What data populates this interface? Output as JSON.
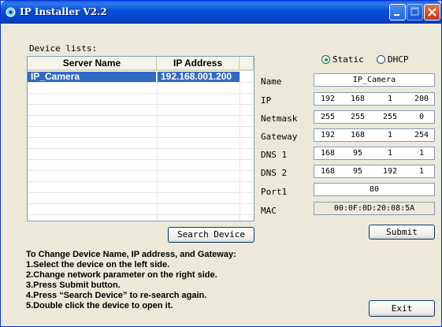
{
  "window": {
    "title": "IP Installer V2.2"
  },
  "device_list": {
    "label": "Device lists:",
    "columns": [
      "Server Name",
      "IP Address"
    ],
    "rows": [
      {
        "server_name": "IP_Camera",
        "ip_address": "192.168.001.200",
        "selected": true
      }
    ]
  },
  "buttons": {
    "search": "Search Device",
    "submit": "Submit",
    "exit": "Exit"
  },
  "mode": {
    "static_label": "Static",
    "dhcp_label": "DHCP",
    "selected": "Static"
  },
  "form": {
    "name": {
      "label": "Name",
      "value": "IP_Camera"
    },
    "ip": {
      "label": "IP",
      "octets": [
        "192",
        "168",
        "1",
        "200"
      ]
    },
    "netmask": {
      "label": "Netmask",
      "octets": [
        "255",
        "255",
        "255",
        "0"
      ]
    },
    "gateway": {
      "label": "Gateway",
      "octets": [
        "192",
        "168",
        "1",
        "254"
      ]
    },
    "dns1": {
      "label": "DNS 1",
      "octets": [
        "168",
        "95",
        "1",
        "1"
      ]
    },
    "dns2": {
      "label": "DNS 2",
      "octets": [
        "168",
        "95",
        "192",
        "1"
      ]
    },
    "port": {
      "label": "Port1",
      "value": "80"
    },
    "mac": {
      "label": "MAC",
      "value": "00:0F:0D:20:08:5A"
    }
  },
  "instructions": {
    "title": "To Change Device Name, IP address, and Gateway:",
    "steps": [
      "1.Select the device on the left side.",
      "2.Change network parameter on the right side.",
      "3.Press Submit button.",
      "4.Press “Search Device” to re-search again.",
      "5.Double click the device to open it."
    ]
  },
  "colors": {
    "titlebar": "#0852d8",
    "selection": "#316ac5",
    "background": "#ece9d8"
  }
}
